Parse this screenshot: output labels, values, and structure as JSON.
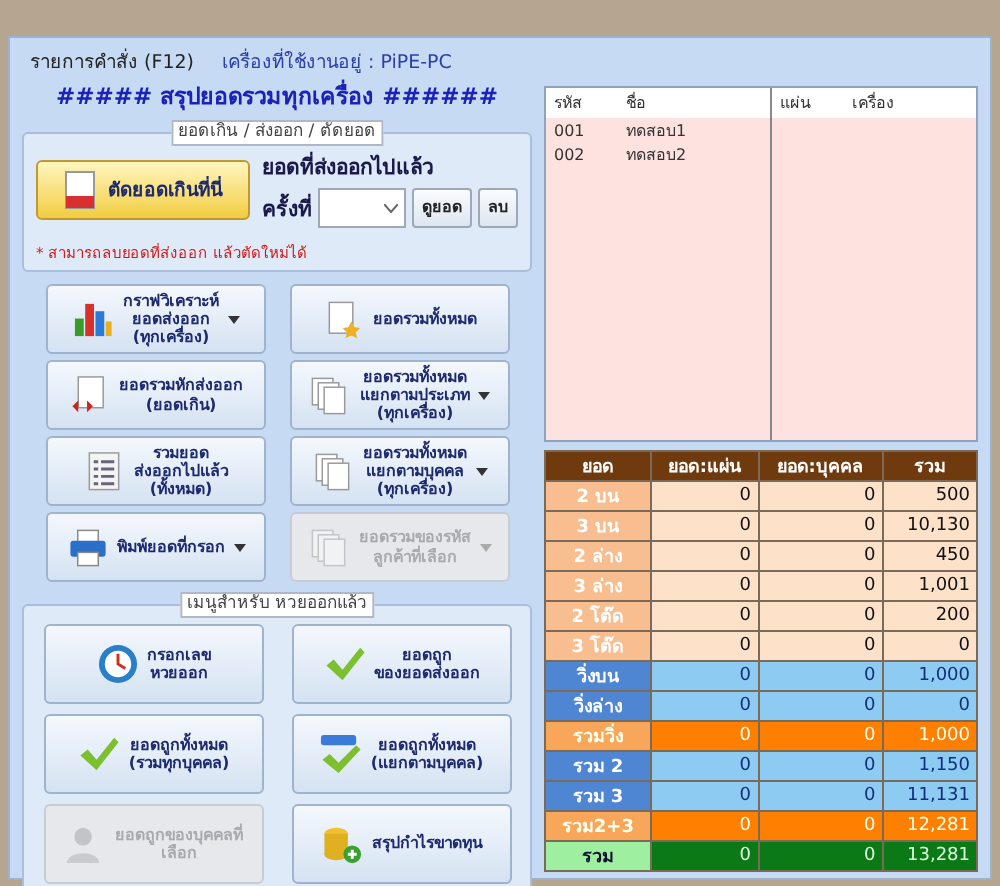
{
  "header": {
    "menu": "รายการคำสั่ง (F12)",
    "machine": "เครื่องที่ใช้งานอยู่ : PiPE-PC"
  },
  "title": "##### สรุปยอดรวมทุกเครื่อง ######",
  "export_group": {
    "legend": "ยอดเกิน / ส่งออก / ตัดยอด",
    "cut_button": "ตัดยอดเกินที่นี่",
    "exported_label": "ยอดที่ส่งออกไปแล้ว",
    "round_label": "ครั้งที่",
    "view_button": "ดูยอด",
    "delete_button": "ลบ",
    "note": "* สามารถลบยอดที่ส่งออก แล้วตัดใหม่ได้"
  },
  "buttons": [
    {
      "kind": "chart",
      "lines": [
        "กราฟวิเคราะห์",
        "ยอดส่งออก",
        "(ทุกเครื่อง)"
      ],
      "dropdown": true,
      "disabled": false
    },
    {
      "kind": "star-doc",
      "lines": [
        "ยอดรวมทั้งหมด"
      ],
      "dropdown": false,
      "disabled": false
    },
    {
      "kind": "arrow-doc",
      "lines": [
        "ยอดรวมหักส่งออก",
        "(ยอดเกิน)"
      ],
      "dropdown": false,
      "disabled": false
    },
    {
      "kind": "docs",
      "lines": [
        "ยอดรวมทั้งหมด",
        "แยกตามประเภท",
        "(ทุกเครื่อง)"
      ],
      "dropdown": true,
      "disabled": false
    },
    {
      "kind": "list",
      "lines": [
        "รวมยอด",
        "ส่งออกไปแล้ว",
        "(ทั้งหมด)"
      ],
      "dropdown": false,
      "disabled": false
    },
    {
      "kind": "docs",
      "lines": [
        "ยอดรวมทั้งหมด",
        "แยกตามบุคคล",
        "(ทุกเครื่อง)"
      ],
      "dropdown": true,
      "disabled": false
    },
    {
      "kind": "printer",
      "lines": [
        "พิมพ์ยอดที่กรอก"
      ],
      "dropdown": true,
      "disabled": false
    },
    {
      "kind": "docs",
      "lines": [
        "ยอดรวมของรหัส",
        "ลูกค้าที่เลือก"
      ],
      "dropdown": true,
      "disabled": true
    }
  ],
  "result_group": {
    "legend": "เมนูสำหรับ หวยออกแล้ว",
    "buttons": [
      {
        "kind": "clock",
        "lines": [
          "กรอกเลข",
          "หวยออก"
        ],
        "disabled": false
      },
      {
        "kind": "check",
        "lines": [
          "ยอดถูก",
          "ของยอดส่งออก"
        ],
        "disabled": false
      },
      {
        "kind": "check",
        "lines": [
          "ยอดถูกทั้งหมด",
          "(รวมทุกบุคคล)"
        ],
        "disabled": false
      },
      {
        "kind": "abc-check",
        "lines": [
          "ยอดถูกทั้งหมด",
          "(แยกตามบุคคล)"
        ],
        "disabled": false
      },
      {
        "kind": "person",
        "lines": [
          "ยอดถูกของบุคคลที่",
          "เลือก"
        ],
        "disabled": true
      },
      {
        "kind": "coins",
        "lines": [
          "สรุปกำไรขาดทุน"
        ],
        "disabled": false
      }
    ]
  },
  "customers": {
    "columns": [
      "รหัส",
      "ชื่อ"
    ],
    "rows": [
      [
        "001",
        "ทดสอบ1"
      ],
      [
        "002",
        "ทดสอบ2"
      ]
    ]
  },
  "machines": {
    "columns": [
      "แผ่น",
      "เครื่อง"
    ]
  },
  "totals": {
    "columns": [
      "ยอด",
      "ยอด:แผ่น",
      "ยอด:บุคคล",
      "รวม"
    ],
    "rows": [
      {
        "kind": "type",
        "cells": [
          "2 บน",
          "0",
          "0",
          "500"
        ]
      },
      {
        "kind": "type",
        "cells": [
          "3 บน",
          "0",
          "0",
          "10,130"
        ]
      },
      {
        "kind": "type",
        "cells": [
          "2 ล่าง",
          "0",
          "0",
          "450"
        ]
      },
      {
        "kind": "type",
        "cells": [
          "3 ล่าง",
          "0",
          "0",
          "1,001"
        ]
      },
      {
        "kind": "type",
        "cells": [
          "2 โต๊ด",
          "0",
          "0",
          "200"
        ]
      },
      {
        "kind": "type",
        "cells": [
          "3 โต๊ด",
          "0",
          "0",
          "0"
        ]
      },
      {
        "kind": "sub",
        "cells": [
          "วิ่งบน",
          "0",
          "0",
          "1,000"
        ]
      },
      {
        "kind": "sub",
        "cells": [
          "วิ่งล่าง",
          "0",
          "0",
          "0"
        ]
      },
      {
        "kind": "sum",
        "cells": [
          "รวมวิ่ง",
          "0",
          "0",
          "1,000"
        ]
      },
      {
        "kind": "sub",
        "cells": [
          "รวม 2",
          "0",
          "0",
          "1,150"
        ]
      },
      {
        "kind": "sub",
        "cells": [
          "รวม 3",
          "0",
          "0",
          "11,131"
        ]
      },
      {
        "kind": "sum",
        "cells": [
          "รวม2+3",
          "0",
          "0",
          "12,281"
        ]
      },
      {
        "kind": "grand",
        "cells": [
          "รวม",
          "0",
          "0",
          "13,281"
        ]
      }
    ]
  }
}
